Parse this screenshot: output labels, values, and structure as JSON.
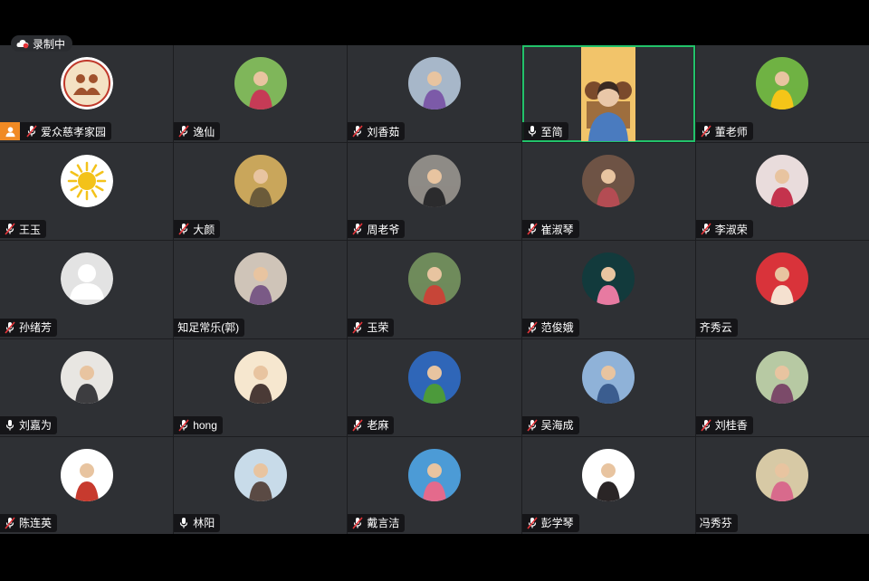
{
  "recording": {
    "label": "录制中"
  },
  "participants": [
    {
      "name": "爱众慈孝家园",
      "mic": "muted",
      "host": true,
      "avatar": "logo",
      "avatar_colors": [
        "#f4e2c4",
        "#a0522d"
      ]
    },
    {
      "name": "逸仙",
      "mic": "muted",
      "avatar": "photo",
      "avatar_colors": [
        "#7fb65a",
        "#c63b56"
      ]
    },
    {
      "name": "刘香茹",
      "mic": "muted",
      "avatar": "photo",
      "avatar_colors": [
        "#a7b7c9",
        "#7c5aa8"
      ]
    },
    {
      "name": "至简",
      "mic": "on",
      "active": true,
      "avatar": "video",
      "avatar_colors": [
        "#f2c46a",
        "#7a4a2c"
      ]
    },
    {
      "name": "董老师",
      "mic": "muted",
      "avatar": "photo",
      "avatar_colors": [
        "#6fb243",
        "#f5c518"
      ]
    },
    {
      "name": "王玉",
      "mic": "muted",
      "avatar": "sun",
      "avatar_colors": [
        "#ffffff",
        "#f3c21a"
      ]
    },
    {
      "name": "大颜",
      "mic": "muted",
      "avatar": "photo",
      "avatar_colors": [
        "#c9a65b",
        "#6b5b3a"
      ]
    },
    {
      "name": "周老爷",
      "mic": "muted",
      "avatar": "photo",
      "avatar_colors": [
        "#8e8b86",
        "#2b2b2d"
      ]
    },
    {
      "name": "崔淑琴",
      "mic": "muted",
      "avatar": "photo",
      "avatar_colors": [
        "#6e5345",
        "#b44c53"
      ]
    },
    {
      "name": "李淑荣",
      "mic": "muted",
      "avatar": "photo",
      "avatar_colors": [
        "#e9dcdc",
        "#c4334d"
      ]
    },
    {
      "name": "孙绪芳",
      "mic": "muted",
      "avatar": "default",
      "avatar_colors": [
        "#e3e3e3",
        "#ffffff"
      ]
    },
    {
      "name": "知足常乐(郭)",
      "mic": "none",
      "avatar": "photo",
      "avatar_colors": [
        "#cfc4b8",
        "#7a5a86"
      ]
    },
    {
      "name": "玉荣",
      "mic": "muted",
      "avatar": "photo",
      "avatar_colors": [
        "#6f8b5b",
        "#c74538"
      ]
    },
    {
      "name": "范俊娥",
      "mic": "muted",
      "avatar": "photo",
      "avatar_colors": [
        "#123a3c",
        "#e77aa1"
      ]
    },
    {
      "name": "齐秀云",
      "mic": "none",
      "avatar": "photo",
      "avatar_colors": [
        "#d9333a",
        "#f5e1d0"
      ]
    },
    {
      "name": "刘嘉为",
      "mic": "on",
      "avatar": "photo",
      "avatar_colors": [
        "#e8e6e2",
        "#3d3d40"
      ]
    },
    {
      "name": "hong",
      "mic": "muted",
      "avatar": "photo",
      "avatar_colors": [
        "#f6e7cf",
        "#4a3a36"
      ]
    },
    {
      "name": "老麻",
      "mic": "muted",
      "avatar": "photo",
      "avatar_colors": [
        "#2f66b8",
        "#4c9a3b"
      ]
    },
    {
      "name": "吴海成",
      "mic": "muted",
      "avatar": "photo",
      "avatar_colors": [
        "#8fb2d8",
        "#3b5d8f"
      ]
    },
    {
      "name": "刘桂香",
      "mic": "muted",
      "avatar": "photo",
      "avatar_colors": [
        "#b7c9a3",
        "#7b4a69"
      ]
    },
    {
      "name": "陈连英",
      "mic": "muted",
      "avatar": "photo",
      "avatar_colors": [
        "#ffffff",
        "#c73a2e"
      ]
    },
    {
      "name": "林阳",
      "mic": "on",
      "avatar": "photo",
      "avatar_colors": [
        "#c8dbe9",
        "#5a4a44"
      ]
    },
    {
      "name": "戴言洁",
      "mic": "muted",
      "avatar": "photo",
      "avatar_colors": [
        "#4c9bd6",
        "#e46a8c"
      ]
    },
    {
      "name": "彭学琴",
      "mic": "muted",
      "avatar": "photo",
      "avatar_colors": [
        "#ffffff",
        "#2a2526"
      ]
    },
    {
      "name": "冯秀芬",
      "mic": "none",
      "avatar": "photo",
      "avatar_colors": [
        "#d7c9a5",
        "#d86a8c"
      ]
    }
  ]
}
